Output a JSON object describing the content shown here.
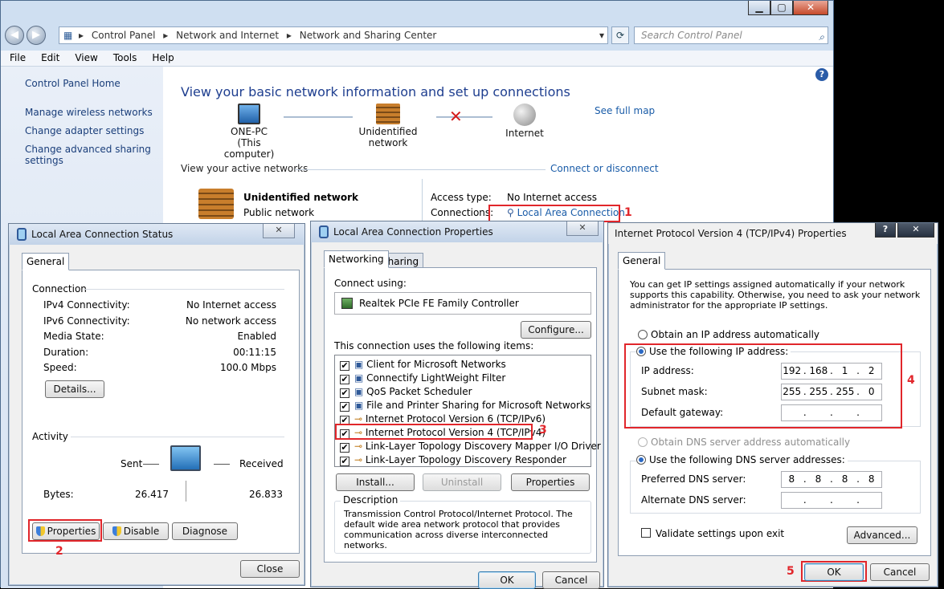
{
  "window": {
    "minimize_icon": "minimize-icon",
    "maximize_icon": "maximize-icon",
    "close_icon": "close-icon"
  },
  "address": {
    "breadcrumb": [
      "Control Panel",
      "Network and Internet",
      "Network and Sharing Center"
    ],
    "search_placeholder": "Search Control Panel"
  },
  "menu": [
    "File",
    "Edit",
    "View",
    "Tools",
    "Help"
  ],
  "sidebar": {
    "home": "Control Panel Home",
    "items": [
      "Manage wireless networks",
      "Change adapter settings",
      "Change advanced sharing settings"
    ]
  },
  "center": {
    "title": "View your basic network information and set up connections",
    "see_full_map": "See full map",
    "computer_name": "ONE-PC",
    "computer_sub": "(This computer)",
    "network_node": "Unidentified network",
    "internet_node": "Internet",
    "active_networks": "View your active networks",
    "connect_disconnect": "Connect or disconnect",
    "network_name": "Unidentified network",
    "network_type": "Public network",
    "access_type_label": "Access type:",
    "access_type_value": "No Internet access",
    "connections_label": "Connections:",
    "connections_value": "Local Area Connection"
  },
  "annotations": {
    "n1": "1",
    "n2": "2",
    "n3": "3",
    "n4": "4",
    "n5": "5",
    "color": "#e1262b"
  },
  "status_dialog": {
    "title": "Local Area Connection Status",
    "tab": "General",
    "connection_label": "Connection",
    "rows": [
      {
        "label": "IPv4 Connectivity:",
        "value": "No Internet access"
      },
      {
        "label": "IPv6 Connectivity:",
        "value": "No network access"
      },
      {
        "label": "Media State:",
        "value": "Enabled"
      },
      {
        "label": "Duration:",
        "value": "00:11:15"
      },
      {
        "label": "Speed:",
        "value": "100.0 Mbps"
      }
    ],
    "details_button": "Details...",
    "activity_label": "Activity",
    "sent_label": "Sent",
    "received_label": "Received",
    "bytes_label": "Bytes:",
    "bytes_sent": "26.417",
    "bytes_received": "26.833",
    "properties_button": "Properties",
    "disable_button": "Disable",
    "diagnose_button": "Diagnose",
    "close_button": "Close"
  },
  "props_dialog": {
    "title": "Local Area Connection Properties",
    "tab_networking": "Networking",
    "tab_sharing": "Sharing",
    "connect_using_label": "Connect using:",
    "adapter": "Realtek PCIe FE Family Controller",
    "configure_button": "Configure...",
    "items_label": "This connection uses the following items:",
    "items": [
      "Client for Microsoft Networks",
      "Connectify LightWeight Filter",
      "QoS Packet Scheduler",
      "File and Printer Sharing for Microsoft Networks",
      "Internet Protocol Version 6 (TCP/IPv6)",
      "Internet Protocol Version 4 (TCP/IPv4)",
      "Link-Layer Topology Discovery Mapper I/O Driver",
      "Link-Layer Topology Discovery Responder"
    ],
    "install_button": "Install...",
    "uninstall_button": "Uninstall",
    "properties_button": "Properties",
    "description_label": "Description",
    "description_text": "Transmission Control Protocol/Internet Protocol. The default wide area network protocol that provides communication across diverse interconnected networks.",
    "ok_button": "OK",
    "cancel_button": "Cancel"
  },
  "ipv4_dialog": {
    "title": "Internet Protocol Version 4 (TCP/IPv4) Properties",
    "help_label": "?",
    "tab": "General",
    "intro": "You can get IP settings assigned automatically if your network supports this capability. Otherwise, you need to ask your network administrator for the appropriate IP settings.",
    "obtain_ip_auto": "Obtain an IP address automatically",
    "use_following_ip": "Use the following IP address:",
    "ip_label": "IP address:",
    "ip": [
      "192",
      "168",
      "1",
      "2"
    ],
    "mask_label": "Subnet mask:",
    "mask": [
      "255",
      "255",
      "255",
      "0"
    ],
    "gateway_label": "Default gateway:",
    "obtain_dns_auto": "Obtain DNS server address automatically",
    "use_following_dns": "Use the following DNS server addresses:",
    "preferred_dns_label": "Preferred DNS server:",
    "preferred_dns": [
      "8",
      "8",
      "8",
      "8"
    ],
    "alternate_dns_label": "Alternate DNS server:",
    "validate_label": "Validate settings upon exit",
    "advanced_button": "Advanced...",
    "ok_button": "OK",
    "cancel_button": "Cancel"
  }
}
